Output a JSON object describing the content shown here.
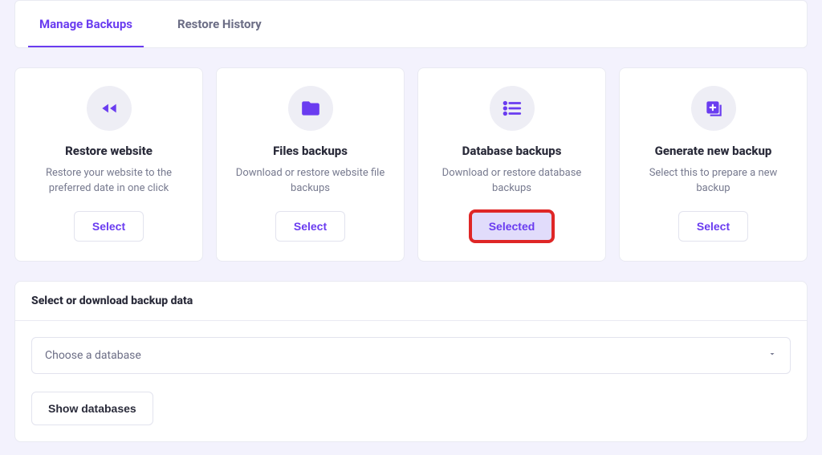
{
  "tabs": {
    "manage": "Manage Backups",
    "restore": "Restore History"
  },
  "cards": {
    "restoreWebsite": {
      "title": "Restore website",
      "desc": "Restore your website to the preferred date in one click",
      "button": "Select"
    },
    "filesBackups": {
      "title": "Files backups",
      "desc": "Download or restore website file backups",
      "button": "Select"
    },
    "databaseBackups": {
      "title": "Database backups",
      "desc": "Download or restore database backups",
      "button": "Selected"
    },
    "generateNew": {
      "title": "Generate new backup",
      "desc": "Select this to prepare a new backup",
      "button": "Select"
    }
  },
  "panel": {
    "header": "Select or download backup data",
    "selectPlaceholder": "Choose a database",
    "showDatabases": "Show databases"
  },
  "colors": {
    "accent": "#6a3cf0",
    "highlight": "#df2626"
  }
}
